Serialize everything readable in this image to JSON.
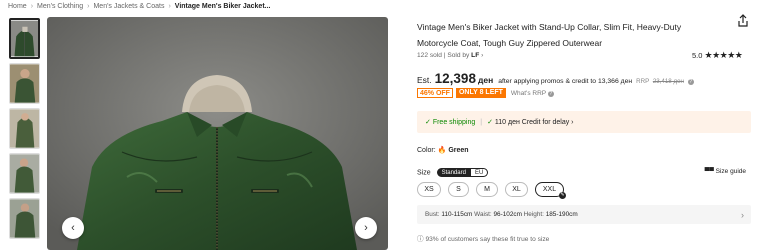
{
  "breadcrumb": [
    "Home",
    "Men's Clothing",
    "Men's Jackets & Coats",
    "Vintage Men's Biker Jacket..."
  ],
  "product": {
    "title": "Vintage Men's Biker Jacket with Stand-Up Collar, Slim Fit, Heavy-Duty Motorcycle Coat, Tough Guy Zippered Outerwear",
    "sold": "122 sold",
    "sold_by_label": "Sold by",
    "seller": "LF",
    "rating": "5.0",
    "stars": "★★★★★",
    "est_label": "Est.",
    "price": "12,398",
    "currency": "ден",
    "promo_text": "after applying promos & credit to 13,366 ден",
    "rrp_label": "RRP",
    "rrp_value": "23,418 ден",
    "discount": "46% OFF",
    "stock_badge": "ONLY 8 LEFT",
    "whats_rrp": "What's RRP",
    "free_shipping": "Free shipping",
    "credit_delay": "110 ден Credit for delay",
    "color_label": "Color:",
    "color_value": "Green",
    "size_label": "Size",
    "size_standard": "Standard",
    "size_eu": "EU",
    "size_guide": "Size guide",
    "sizes": [
      "XS",
      "S",
      "M",
      "XL",
      "XXL"
    ],
    "selected_size": "XXL",
    "fit_bust_label": "Bust:",
    "fit_bust": "110-115cm",
    "fit_waist_label": "Waist:",
    "fit_waist": "96-102cm",
    "fit_height_label": "Height:",
    "fit_height": "185-190cm",
    "fit_note": "93% of customers say these fit true to size"
  },
  "colors": {
    "accent": "#fb7701",
    "green": "#0a8800",
    "ship_bg": "#fef2e8"
  },
  "icons": [
    "share-icon",
    "check-icon",
    "info-icon",
    "flame-icon",
    "ruler-icon",
    "chevron-right-icon",
    "chevron-left-icon"
  ]
}
